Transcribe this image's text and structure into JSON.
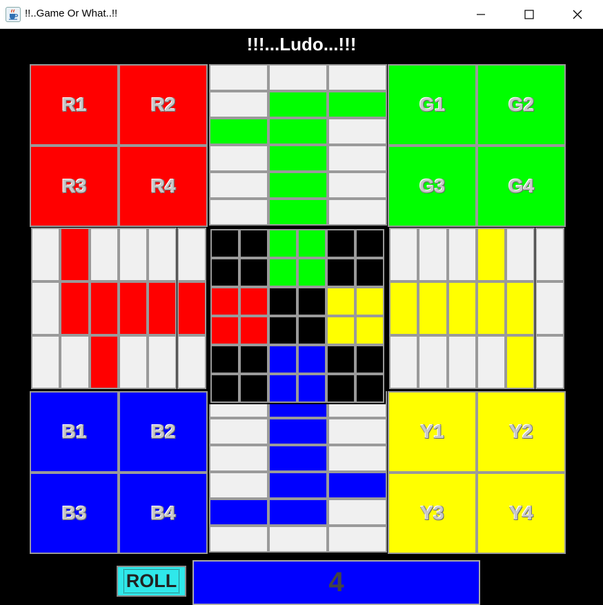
{
  "window": {
    "title": "!!..Game Or What..!!",
    "app_icon": "java-cup-icon",
    "controls": [
      "minimize-icon",
      "maximize-icon",
      "close-icon"
    ]
  },
  "game": {
    "title": "!!!...Ludo...!!!"
  },
  "colors": {
    "red": "#ff0000",
    "green": "#00ff00",
    "yellow": "#ffff00",
    "blue": "#0000ff",
    "empty": "#f0f0f0",
    "center_black": "#000000",
    "border": "#9a9a9a",
    "roll_button": "#2fe8ea"
  },
  "homes": {
    "red": [
      "R1",
      "R2",
      "R3",
      "R4"
    ],
    "green": [
      "G1",
      "G2",
      "G3",
      "G4"
    ],
    "blue": [
      "B1",
      "B2",
      "B3",
      "B4"
    ],
    "yellow": [
      "Y1",
      "Y2",
      "Y3",
      "Y4"
    ]
  },
  "board": {
    "top_arm": [
      [
        "empty",
        "empty",
        "empty"
      ],
      [
        "empty",
        "green",
        "green"
      ],
      [
        "green",
        "green",
        "empty"
      ],
      [
        "empty",
        "green",
        "empty"
      ],
      [
        "empty",
        "green",
        "empty"
      ],
      [
        "empty",
        "green",
        "empty"
      ]
    ],
    "bottom_arm": [
      [
        "empty",
        "blue",
        "empty"
      ],
      [
        "empty",
        "blue",
        "empty"
      ],
      [
        "empty",
        "blue",
        "empty"
      ],
      [
        "empty",
        "blue",
        "blue"
      ],
      [
        "blue",
        "blue",
        "empty"
      ],
      [
        "empty",
        "empty",
        "empty"
      ]
    ],
    "left_arm": [
      [
        "empty",
        "red",
        "empty",
        "empty",
        "empty",
        "empty"
      ],
      [
        "empty",
        "red",
        "red",
        "red",
        "red",
        "red"
      ],
      [
        "empty",
        "empty",
        "red",
        "empty",
        "empty",
        "empty"
      ]
    ],
    "right_arm": [
      [
        "empty",
        "empty",
        "empty",
        "yellow",
        "empty",
        "empty"
      ],
      [
        "yellow",
        "yellow",
        "yellow",
        "yellow",
        "yellow",
        "empty"
      ],
      [
        "empty",
        "empty",
        "empty",
        "empty",
        "yellow",
        "empty"
      ]
    ],
    "center": [
      [
        "black",
        "black",
        "green",
        "green",
        "black",
        "black"
      ],
      [
        "black",
        "black",
        "green",
        "green",
        "black",
        "black"
      ],
      [
        "red",
        "red",
        "black",
        "black",
        "yellow",
        "yellow"
      ],
      [
        "red",
        "red",
        "black",
        "black",
        "yellow",
        "yellow"
      ],
      [
        "black",
        "black",
        "blue",
        "blue",
        "black",
        "black"
      ],
      [
        "black",
        "black",
        "blue",
        "blue",
        "black",
        "black"
      ]
    ]
  },
  "controls": {
    "roll_label": "ROLL",
    "dice_value": "4",
    "dice_color": "#0000ff"
  }
}
